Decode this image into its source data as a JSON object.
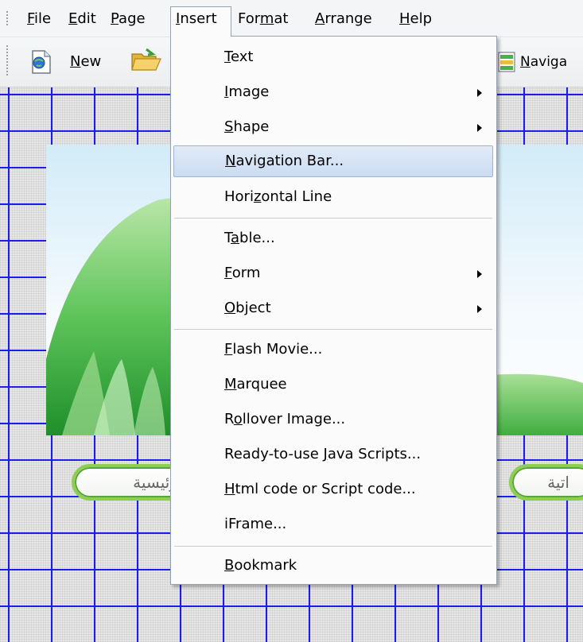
{
  "menubar": {
    "items": [
      {
        "label": "File",
        "mn": "F",
        "rest": "ile"
      },
      {
        "label": "Edit",
        "mn": "E",
        "rest": "dit"
      },
      {
        "label": "Page",
        "mn": "P",
        "rest": "age"
      },
      {
        "label": "Insert",
        "mn": "I",
        "rest": "nsert"
      },
      {
        "label": "Format",
        "pre": "For",
        "mn": "m",
        "post": "at"
      },
      {
        "label": "Arrange",
        "mn": "A",
        "rest": "rrange"
      },
      {
        "label": "Help",
        "mn": "H",
        "rest": "elp"
      }
    ]
  },
  "toolbar": {
    "new": {
      "mn": "N",
      "rest": "ew"
    },
    "navigation": {
      "mn": "N",
      "rest": "aviga"
    }
  },
  "insert_menu": {
    "items": [
      {
        "pre": "",
        "mn": "T",
        "post": "ext"
      },
      {
        "pre": "",
        "mn": "I",
        "post": "mage"
      },
      {
        "pre": "",
        "mn": "S",
        "post": "hape"
      },
      {
        "pre": "",
        "mn": "N",
        "post": "avigation Bar..."
      },
      {
        "pre": "Hori",
        "mn": "z",
        "post": "ontal Line"
      },
      {
        "pre": "T",
        "mn": "a",
        "post": "ble..."
      },
      {
        "pre": "",
        "mn": "F",
        "post": "orm"
      },
      {
        "pre": "",
        "mn": "O",
        "post": "bject"
      },
      {
        "pre": "",
        "mn": "F",
        "post": "lash Movie..."
      },
      {
        "pre": "",
        "mn": "M",
        "post": "arquee"
      },
      {
        "pre": "R",
        "mn": "o",
        "post": "llover Image..."
      },
      {
        "pre": "Ready-to-use ",
        "mn": "J",
        "post": "ava Scripts..."
      },
      {
        "pre": "",
        "mn": "H",
        "post": "tml code or Script code..."
      },
      {
        "pre": "iFrame...",
        "mn": "",
        "post": ""
      },
      {
        "pre": "",
        "mn": "B",
        "post": "ookmark"
      }
    ]
  },
  "canvas": {
    "nav_buttons": [
      {
        "label": "الرئيسية"
      },
      {
        "label": "اتية"
      }
    ]
  }
}
